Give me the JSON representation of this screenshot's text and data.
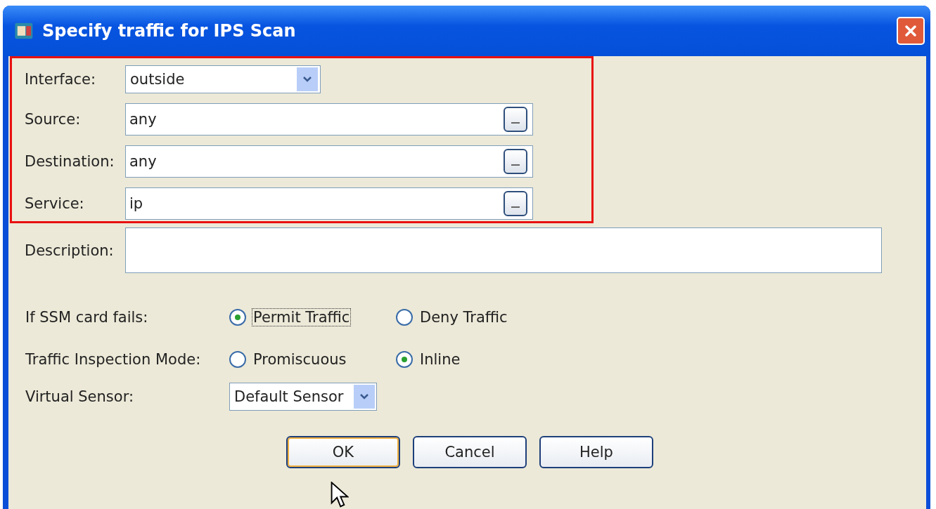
{
  "window": {
    "title": "Specify traffic for IPS Scan"
  },
  "highlighted_fields": [
    {
      "kind": "dropdown",
      "label": "Interface:",
      "value": "outside"
    },
    {
      "kind": "browse",
      "label": "Source:",
      "value": "any"
    },
    {
      "kind": "browse",
      "label": "Destination:",
      "value": "any"
    },
    {
      "kind": "browse",
      "label": "Service:",
      "value": "ip"
    }
  ],
  "description": {
    "label": "Description:"
  },
  "radio_groups": [
    {
      "label": "If SSM card fails:",
      "options": [
        {
          "label": "Permit Traffic",
          "selected": true,
          "focused": true
        },
        {
          "label": "Deny Traffic",
          "selected": false,
          "focused": false
        }
      ]
    },
    {
      "label": "Traffic Inspection Mode:",
      "options": [
        {
          "label": "Promiscuous",
          "selected": false,
          "focused": false
        },
        {
          "label": "Inline",
          "selected": true,
          "focused": false
        }
      ]
    }
  ],
  "virtual_sensor": {
    "label": "Virtual Sensor:",
    "value": "Default Sensor"
  },
  "buttons": [
    {
      "label": "OK",
      "default": true
    },
    {
      "label": "Cancel",
      "default": false
    },
    {
      "label": "Help",
      "default": false
    }
  ]
}
